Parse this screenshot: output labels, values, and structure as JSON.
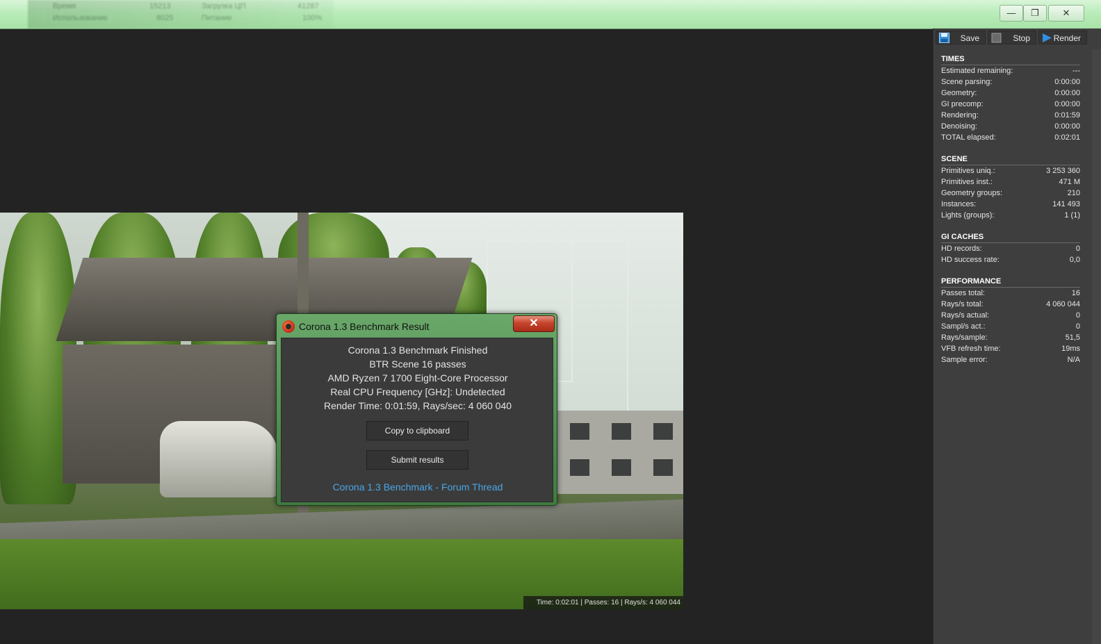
{
  "window": {
    "ghost_labels": [
      "Время",
      "15213",
      "Загрузка ЦП",
      "41287",
      "Использование",
      "8025",
      "Питание",
      "100%"
    ],
    "controls": {
      "minimize": "—",
      "maximize": "❐",
      "close": "✕"
    }
  },
  "viewport": {
    "status_line": "Time: 0:02:01 | Passes: 16 | Rays/s: 4 060 044"
  },
  "toolbar": {
    "save_label": "Save",
    "stop_label": "Stop",
    "render_label": "Render",
    "accent_color": "#2f8fe0"
  },
  "stats": {
    "times": {
      "title": "TIMES",
      "rows": [
        {
          "label": "Estimated remaining:",
          "value": "---"
        },
        {
          "label": "Scene parsing:",
          "value": "0:00:00"
        },
        {
          "label": "Geometry:",
          "value": "0:00:00"
        },
        {
          "label": "GI precomp:",
          "value": "0:00:00"
        },
        {
          "label": "Rendering:",
          "value": "0:01:59"
        },
        {
          "label": "Denoising:",
          "value": "0:00:00"
        },
        {
          "label": "TOTAL elapsed:",
          "value": "0:02:01"
        }
      ]
    },
    "scene": {
      "title": "SCENE",
      "rows": [
        {
          "label": "Primitives uniq.:",
          "value": "3 253 360"
        },
        {
          "label": "Primitives inst.:",
          "value": "471 M"
        },
        {
          "label": "Geometry groups:",
          "value": "210"
        },
        {
          "label": "Instances:",
          "value": "141 493"
        },
        {
          "label": "Lights (groups):",
          "value": "1 (1)"
        }
      ]
    },
    "gi_caches": {
      "title": "GI CACHES",
      "rows": [
        {
          "label": "HD records:",
          "value": "0"
        },
        {
          "label": "HD success rate:",
          "value": "0,0"
        }
      ]
    },
    "performance": {
      "title": "PERFORMANCE",
      "rows": [
        {
          "label": "Passes total:",
          "value": "16"
        },
        {
          "label": "Rays/s total:",
          "value": "4 060 044"
        },
        {
          "label": "Rays/s actual:",
          "value": "0"
        },
        {
          "label": "Sampl/s act.:",
          "value": "0"
        },
        {
          "label": "Rays/sample:",
          "value": "51,5"
        },
        {
          "label": "VFB refresh time:",
          "value": "19ms"
        },
        {
          "label": "Sample error:",
          "value": "N/A"
        }
      ]
    }
  },
  "dialog": {
    "title": "Corona 1.3 Benchmark Result",
    "close_glyph": "✕",
    "lines": [
      "Corona 1.3 Benchmark Finished",
      "BTR Scene 16 passes",
      "AMD Ryzen 7 1700 Eight-Core Processor",
      "Real CPU Frequency [GHz]: Undetected",
      "Render Time: 0:01:59, Rays/sec: 4 060 040"
    ],
    "copy_button": "Copy to clipboard",
    "submit_button": "Submit results",
    "forum_link": "Corona 1.3 Benchmark - Forum Thread"
  }
}
